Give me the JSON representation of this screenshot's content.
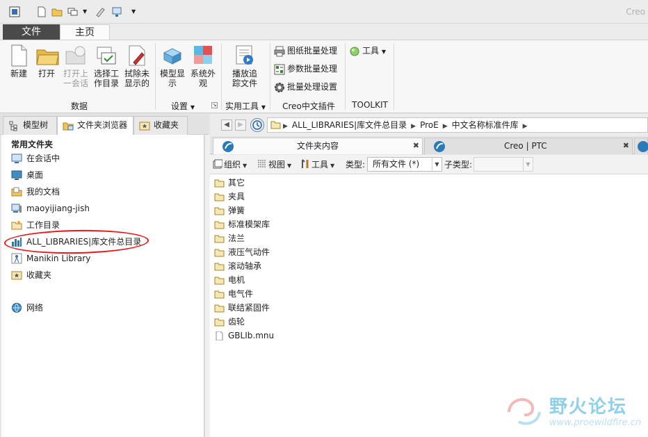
{
  "app": {
    "title": "Creo"
  },
  "ribbon": {
    "tabs": {
      "file": "文件",
      "home": "主页"
    },
    "buttons": {
      "new": "新建",
      "open": "打开",
      "open_session_1": "打开上",
      "open_session_2": "一会话",
      "select_wd_1": "选择工",
      "select_wd_2": "作目录",
      "erase_1": "拭除未",
      "erase_2": "显示的",
      "model_display_1": "模型显",
      "model_display_2": "示",
      "system_appearance_1": "系统外",
      "system_appearance_2": "观",
      "play_trail_1": "播放追",
      "play_trail_2": "踪文件",
      "drawing_batch": "图纸批量处理",
      "param_batch": "参数批量处理",
      "batch_settings": "批量处理设置",
      "tools": "工具"
    },
    "groups": {
      "data": "数据",
      "settings": "设置",
      "utilities": "实用工具",
      "creo_plugin": "Creo中文插件",
      "toolkit": "TOOLKIT"
    }
  },
  "left": {
    "tabs": {
      "model_tree": "模型树",
      "folder_browser": "文件夹浏览器",
      "favorites": "收藏夹"
    },
    "section_title": "常用文件夹",
    "items": [
      {
        "label": "在会话中",
        "icon": "session-icon"
      },
      {
        "label": "桌面",
        "icon": "desktop-icon"
      },
      {
        "label": "我的文档",
        "icon": "documents-icon"
      },
      {
        "label": "maoyijiang-jish",
        "icon": "computer-icon"
      },
      {
        "label": "工作目录",
        "icon": "working-dir-icon"
      },
      {
        "label": "ALL_LIBRARIES|库文件总目录",
        "icon": "library-icon"
      },
      {
        "label": "Manikin Library",
        "icon": "manikin-icon"
      },
      {
        "label": "收藏夹",
        "icon": "favorites-icon"
      },
      {
        "label": "网络",
        "icon": "network-icon"
      }
    ]
  },
  "browser": {
    "breadcrumbs": [
      "ALL_LIBRARIES|库文件总目录",
      "ProE",
      "中文名称标准件库"
    ],
    "tabs": {
      "folder_contents": "文件夹内容",
      "creo_ptc": "Creo | PTC"
    },
    "toolbar": {
      "organize": "组织",
      "view": "视图",
      "tools": "工具",
      "type_label": "类型:",
      "type_value": "所有文件 (*)",
      "subtype_label": "子类型:"
    },
    "files": [
      {
        "name": "其它",
        "kind": "folder"
      },
      {
        "name": "夹具",
        "kind": "folder"
      },
      {
        "name": "弹簧",
        "kind": "folder"
      },
      {
        "name": "标准模架库",
        "kind": "folder"
      },
      {
        "name": "法兰",
        "kind": "folder"
      },
      {
        "name": "液压气动件",
        "kind": "folder"
      },
      {
        "name": "滚动轴承",
        "kind": "folder"
      },
      {
        "name": "电机",
        "kind": "folder"
      },
      {
        "name": "电气件",
        "kind": "folder"
      },
      {
        "name": "联结紧固件",
        "kind": "folder"
      },
      {
        "name": "齿轮",
        "kind": "folder"
      },
      {
        "name": "GBLIb.mnu",
        "kind": "file"
      }
    ]
  },
  "watermark": {
    "name": "野火论坛",
    "url": "www.proewildfire.cn"
  },
  "colors": {
    "file_tab": "#4a4a4a",
    "annotation": "#e8181a",
    "folder": "#f0c65a",
    "accent_blue": "#2a7ab8"
  }
}
